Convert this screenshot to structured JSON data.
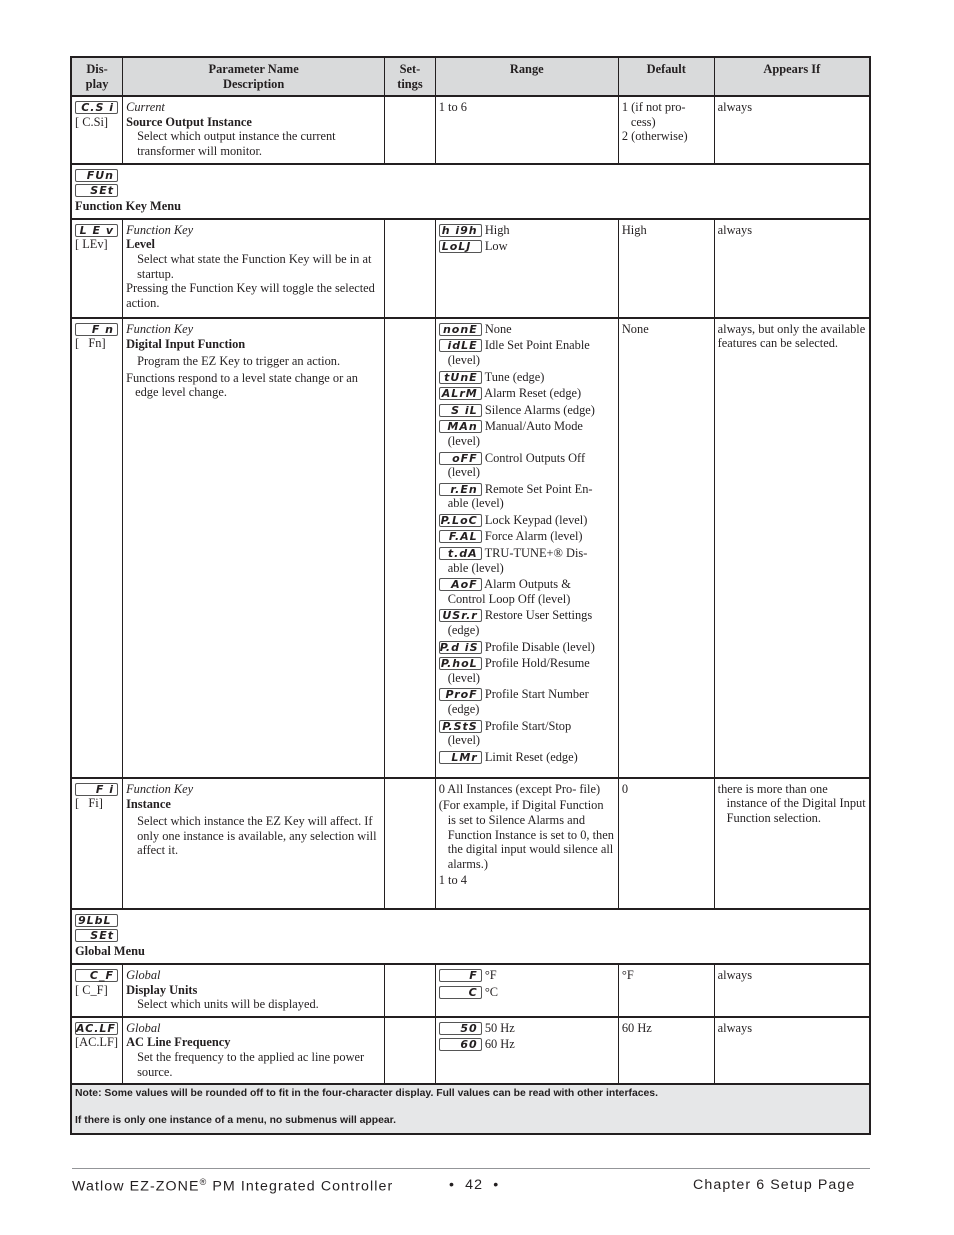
{
  "table": {
    "headers": {
      "display": [
        "Dis-",
        "play"
      ],
      "name": [
        "Parameter Name",
        "Description"
      ],
      "settings": [
        "Set-",
        "tings"
      ],
      "range": "Range",
      "default": "Default",
      "appears_if": "Appears If"
    },
    "rows": [
      {
        "lcd": "C.S i",
        "code": "[ C.Si]",
        "category": "Current",
        "name": "Source Output Instance",
        "desc": [
          "Select which output instance the current transformer will monitor."
        ],
        "range_text": "1 to 6",
        "default": [
          "1 (if not pro-",
          "cess)",
          "2 (otherwise)"
        ],
        "appears_if": "always"
      },
      {
        "lcd": "L E v",
        "code": "[ LEv]",
        "category": "Function Key",
        "name": "Level",
        "desc": [
          "Select what state the Function Key will be in at startup.",
          "Pressing the Function Key will toggle the selected action."
        ],
        "options": [
          {
            "lcd": "h i9h",
            "label": "High"
          },
          {
            "lcd": "LoLJ",
            "label": "Low"
          }
        ],
        "default": "High",
        "appears_if": "always"
      },
      {
        "lcd": "F n",
        "code": "[   Fn]",
        "category": "Function Key",
        "name": "Digital Input Function",
        "desc": [
          "Program the EZ Key to trigger an action.",
          "Functions respond to a level state change or an edge level change."
        ],
        "options": [
          {
            "lcd": "nonE",
            "label": "None"
          },
          {
            "lcd": "idLE",
            "label": "Idle Set Point Enable",
            "cont": "(level)"
          },
          {
            "lcd": "tUnE",
            "label": "Tune (edge)"
          },
          {
            "lcd": "ALrM",
            "label": "Alarm Reset (edge)"
          },
          {
            "lcd": "S iL",
            "label": "Silence Alarms (edge)"
          },
          {
            "lcd": "MAn",
            "label": "Manual/Auto Mode",
            "cont": "(level)"
          },
          {
            "lcd": "oFF",
            "label": "Control Outputs Off",
            "cont": "(level)"
          },
          {
            "lcd": "r.En",
            "label": "Remote Set Point En-",
            "cont": "able (level)"
          },
          {
            "lcd": "P.LoC",
            "label": "Lock Keypad (level)"
          },
          {
            "lcd": "F.AL",
            "label": "Force Alarm (level)"
          },
          {
            "lcd": "t.dA",
            "label": "TRU-TUNE+® Dis-",
            "cont": "able (level)"
          },
          {
            "lcd": "AoF",
            "label": "Alarm Outputs &",
            "cont": "Control Loop Off (level)"
          },
          {
            "lcd": "USr.r",
            "label": "Restore User Settings",
            "cont": "(edge)"
          },
          {
            "lcd": "P.d iS",
            "label": "Profile Disable (level)"
          },
          {
            "lcd": "P.hoL",
            "label": "Profile Hold/Resume",
            "cont": "(level)"
          },
          {
            "lcd": "ProF",
            "label": "Profile Start Number",
            "cont": "(edge)"
          },
          {
            "lcd": "P.StS",
            "label": "Profile Start/Stop",
            "cont": "(level)"
          },
          {
            "lcd": "LMr",
            "label": "Limit Reset (edge)"
          }
        ],
        "default": "None",
        "appears_if": "always, but only the available features can be selected."
      },
      {
        "lcd": "F i",
        "code": "[   Fi]",
        "category": "Function Key",
        "name": "Instance",
        "desc": [
          "Select which instance the EZ Key will affect. If only one instance is available, any selection will affect it."
        ],
        "range": [
          "0 All Instances (except Pro- file)",
          "(For example, if Digital Function is set to Silence Alarms and Function Instance is set to 0, then the digital input would silence all alarms.)",
          "1 to 4"
        ],
        "default": "0",
        "appears_if": "there is more than one instance of the Digital Input Function selection."
      },
      {
        "lcd": "C_F",
        "code": "[ C_F]",
        "category": "Global",
        "name": "Display Units",
        "desc": [
          "Select which units will be displayed."
        ],
        "options": [
          {
            "lcd": "F",
            "label": "°F"
          },
          {
            "lcd": "C",
            "label": "°C"
          }
        ],
        "default": "°F",
        "appears_if": "always"
      },
      {
        "lcd": "AC.LF",
        "code": "[AC.LF]",
        "category": "Global",
        "name": "AC Line Frequency",
        "desc": [
          "Set the frequency to the applied ac line power source."
        ],
        "options": [
          {
            "lcd": "50",
            "label": "50 Hz"
          },
          {
            "lcd": "60",
            "label": "60 Hz"
          }
        ],
        "default": "60 Hz",
        "appears_if": "always"
      }
    ],
    "menus": [
      {
        "lcd1": "FUn",
        "lcd2": "SEt",
        "title": "Function Key Menu"
      },
      {
        "lcd1": "9LbL",
        "lcd2": "SEt",
        "title": "Global Menu"
      }
    ],
    "notes": [
      "Note: Some values will be rounded off to fit in the four-character display. Full values can be read with other interfaces.",
      "If there is only one instance of a menu, no submenus will appear."
    ]
  },
  "footer": {
    "brand": "Watlow EZ-ZONE",
    "reg": "®",
    "product": " PM Integrated Controller",
    "page": "•  42  •",
    "chapter": "Chapter 6 Setup Page"
  }
}
